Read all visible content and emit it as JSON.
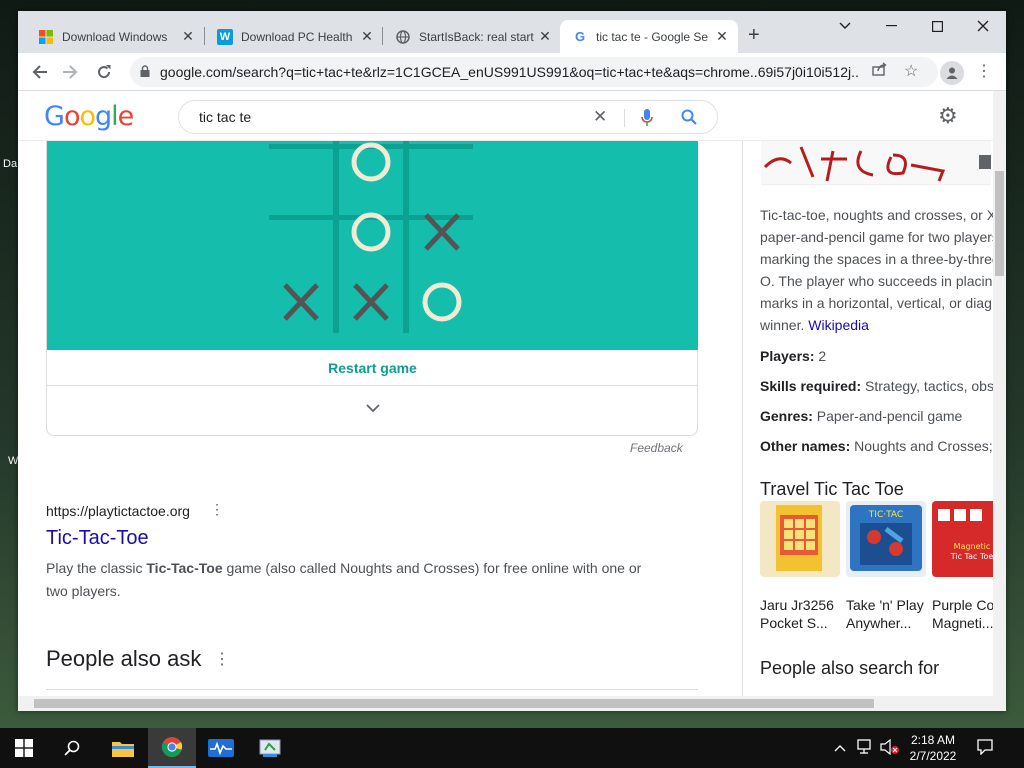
{
  "browser": {
    "tabs": [
      {
        "title": "Download Windows",
        "icon": "windows-logo-icon"
      },
      {
        "title": "Download PC Health",
        "icon": "w-logo-icon"
      },
      {
        "title": "StartIsBack: real start",
        "icon": "globe-icon"
      },
      {
        "title": "tic tac te - Google Se",
        "icon": "google-g-icon",
        "active": true
      }
    ],
    "url": "google.com/search?q=tic+tac+te&rlz=1C1GCEA_enUS991US991&oq=tic+tac+te&aqs=chrome..69i57j0i10i512j..."
  },
  "google": {
    "logo": "Google",
    "query": "tic tac te",
    "colors": {
      "blue": "#4285F4",
      "red": "#EA4335",
      "yellow": "#FBBC05",
      "green": "#34A853"
    }
  },
  "game": {
    "board_color": "#14bdac",
    "restart_label": "Restart game",
    "feedback": "Feedback",
    "board": [
      [
        "",
        "O",
        ""
      ],
      [
        "",
        "O",
        "X"
      ],
      [
        "X",
        "X",
        "O"
      ]
    ]
  },
  "result": {
    "cite": "https://playtictactoe.org",
    "title": "Tic-Tac-Toe",
    "snippet_pre": "Play the classic ",
    "snippet_bold": "Tic-Tac-Toe",
    "snippet_post": " game (also called Noughts and Crosses) for free online with one or",
    "snippet_line2": "two players."
  },
  "paa": {
    "heading": "People also ask"
  },
  "knowledge_panel": {
    "desc_lines": [
      "Tic-tac-toe, noughts and crosses, or Xs",
      "paper-and-pencil game for two players",
      "marking the spaces in a three-by-three",
      "O. The player who succeeds in placing",
      "marks in a horizontal, vertical, or diag"
    ],
    "desc_last": "winner.",
    "wiki_link": "Wikipedia",
    "facts": [
      {
        "label": "Players:",
        "value": " 2"
      },
      {
        "label": "Skills required:",
        "value": " Strategy, tactics, obse"
      },
      {
        "label": "Genres:",
        "value": " Paper-and-pencil game"
      },
      {
        "label": "Other names:",
        "value": " Noughts and Crosses;"
      }
    ],
    "travel_heading": "Travel Tic Tac Toe",
    "products": [
      {
        "line1": "Jaru Jr3256",
        "line2": "Pocket S..."
      },
      {
        "line1": "Take 'n' Play",
        "line2": "Anywher..."
      },
      {
        "line1": "Purple Co",
        "line2": "Magneti..."
      }
    ],
    "also_search": "People also search for"
  },
  "taskbar": {
    "time": "2:18 AM",
    "date": "2/7/2022"
  }
}
